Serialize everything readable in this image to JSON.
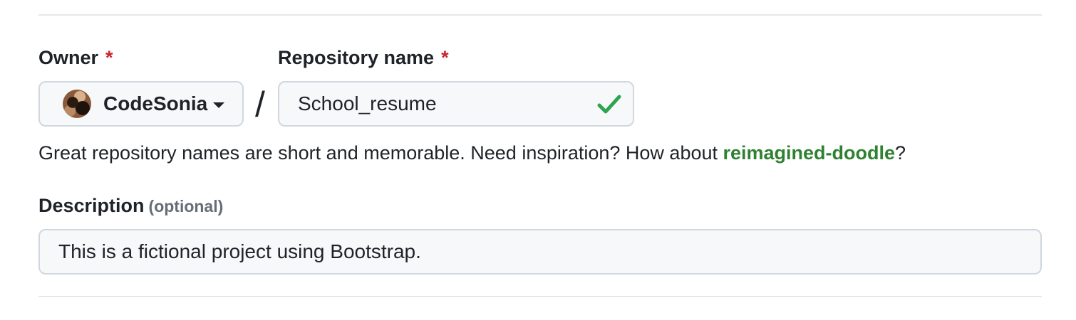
{
  "owner": {
    "label": "Owner",
    "required_mark": "*",
    "selected": "CodeSonia"
  },
  "separator": "/",
  "repository": {
    "label": "Repository name",
    "required_mark": "*",
    "value": "School_resume",
    "valid": true
  },
  "hint": {
    "text": "Great repository names are short and memorable. Need inspiration? How about ",
    "suggestion": "reimagined-doodle",
    "suffix": "?"
  },
  "description": {
    "label": "Description",
    "optional_note": "(optional)",
    "value": "This is a fictional project using Bootstrap."
  },
  "colors": {
    "required": "#cf222e",
    "suggestion": "#2f8132",
    "valid_check": "#2da44e",
    "border": "#d0d7de",
    "input_bg": "#f6f8fa"
  }
}
